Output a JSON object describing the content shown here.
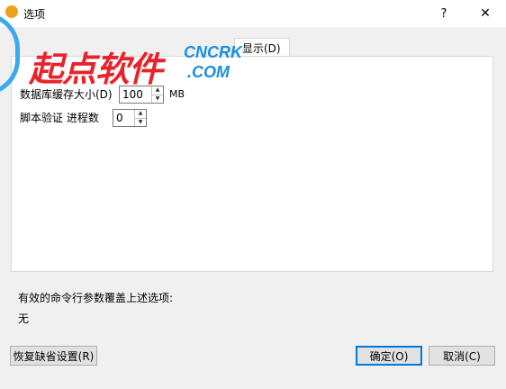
{
  "window": {
    "title": "选项",
    "help_glyph": "?",
    "close_glyph": "✕"
  },
  "watermark": {
    "cn_text": "起点软件",
    "en_line1": "CNCRK",
    "en_line2": ".COM"
  },
  "tabs": [
    {
      "label": "显示(D)"
    }
  ],
  "fields": {
    "db_cache": {
      "label": "数据库缓存大小(D)",
      "value": "100",
      "unit": "MB"
    },
    "script_verify": {
      "label": "脚本验证 进程数",
      "value": "0"
    }
  },
  "info": {
    "override_note": "有效的命令行参数覆盖上述选项:",
    "override_value": "无"
  },
  "buttons": {
    "restore": "恢复缺省设置(R)",
    "ok": "确定(O)",
    "cancel": "取消(C)"
  },
  "colors": {
    "watermark_red": "#e8232b",
    "watermark_blue": "#1a8ee0",
    "default_button_border": "#0078d7"
  }
}
